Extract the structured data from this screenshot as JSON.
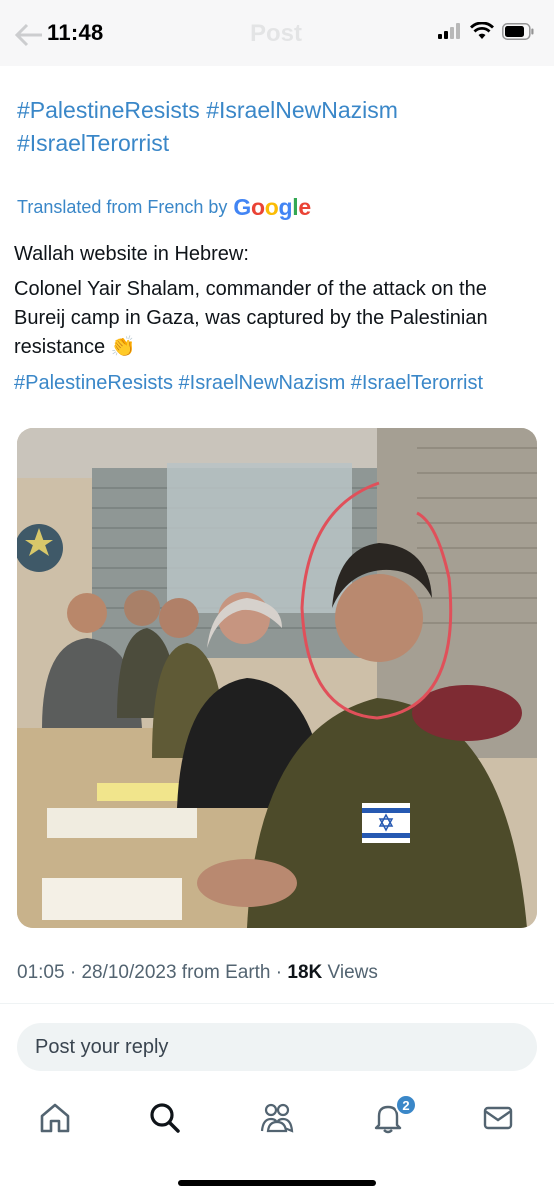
{
  "status_bar": {
    "time": "11:48",
    "header_title": "Post"
  },
  "post": {
    "hashtags_top": "#PalestineResists #IsraelNewNazism #IsraelTerorrist",
    "translated_prefix": "Translated from French by",
    "translated_brand": "Google",
    "body_line1": "Wallah website in Hebrew:",
    "body_line2": "Colonel Yair Shalam, commander of the attack on the Bureij camp in Gaza, was captured by the Palestinian resistance 👏",
    "body_hashtags": "#PalestineResists #IsraelNewNazism #IsraelTerorrist",
    "photo_icon": "news-photo-image"
  },
  "meta": {
    "time": "01:05",
    "sep1": " · ",
    "date": "28/10/2023",
    "source": " from Earth",
    "sep2": " · ",
    "views_count": "18K",
    "views_label": " Views"
  },
  "reply": {
    "placeholder": "Post your reply"
  },
  "nav": {
    "items": [
      "home-icon",
      "search-icon",
      "communities-icon",
      "notifications-icon",
      "messages-icon"
    ],
    "notification_badge": "2"
  },
  "colors": {
    "link": "#3a87c8",
    "text": "#0f1419",
    "muted": "#536471",
    "accent": "#3a87c8"
  }
}
